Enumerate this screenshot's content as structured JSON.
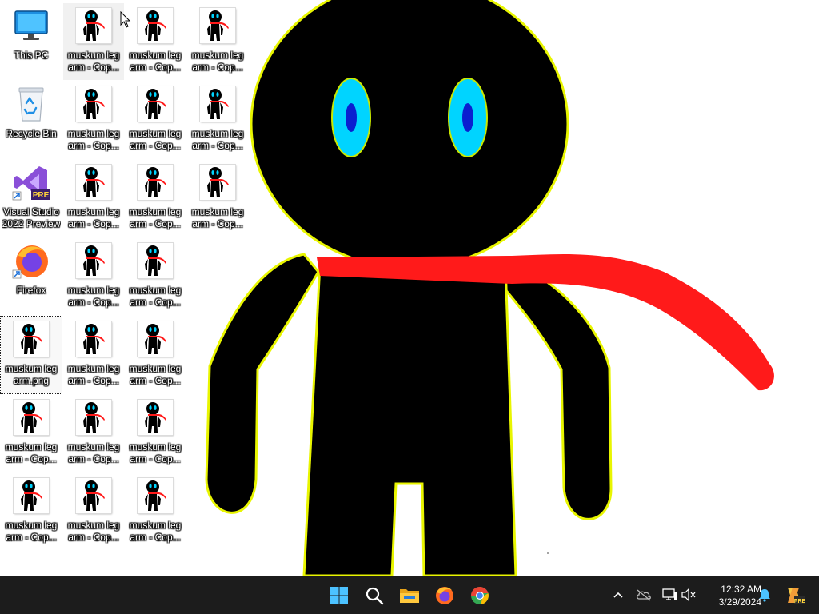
{
  "desktop": {
    "system_icons": [
      {
        "label": "This PC",
        "icon": "monitor-icon"
      },
      {
        "label": "Recycle Bin",
        "icon": "recycle-bin-icon"
      },
      {
        "label": "Visual Studio 2022 Preview",
        "icon": "visual-studio-preview-icon",
        "badge": "PRE"
      },
      {
        "label": "Firefox",
        "icon": "firefox-icon"
      }
    ],
    "file_label": "muskum leg arm - Cop...",
    "selected_file_label": "muskum leg arm.png",
    "wallpaper": {
      "figure_color": "#000000",
      "outline_color": "#e8f500",
      "eye_color": "#00d4ff",
      "pupil_color": "#0a1fd0",
      "scarf_color": "#ff1a1a"
    }
  },
  "taskbar": {
    "apps": [
      {
        "name": "start-button",
        "icon": "windows-logo-icon"
      },
      {
        "name": "search-button",
        "icon": "search-icon"
      },
      {
        "name": "file-explorer-button",
        "icon": "folder-icon"
      },
      {
        "name": "firefox-taskbar-button",
        "icon": "firefox-icon"
      },
      {
        "name": "chrome-taskbar-button",
        "icon": "chrome-icon"
      }
    ],
    "tray": {
      "icons": [
        "chevron-up-icon",
        "onedrive-offline-icon",
        "network-icon",
        "volume-muted-icon",
        "bell-icon",
        "copilot-pre-icon"
      ]
    },
    "clock": {
      "time": "12:32 AM",
      "date": "3/29/2024"
    }
  }
}
